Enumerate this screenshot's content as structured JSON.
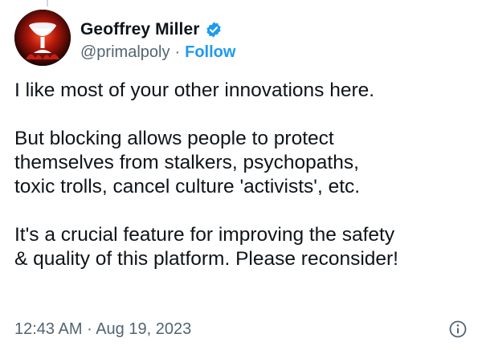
{
  "author": {
    "name": "Geoffrey Miller",
    "handle": "@primalpoly",
    "separator": "·",
    "follow_label": "Follow",
    "verified": true
  },
  "tweet": {
    "paragraphs": [
      [
        "I like most of your other innovations here."
      ],
      [
        "But blocking allows people to protect",
        "themselves from stalkers, psychopaths,",
        "toxic trolls, cancel culture 'activists', etc."
      ],
      [
        "It's a crucial feature for improving the safety",
        "& quality of this platform. Please reconsider!"
      ]
    ],
    "time": "12:43 AM",
    "date_separator": "·",
    "date": "Aug 19, 2023"
  },
  "colors": {
    "accent": "#1d9bf0",
    "text": "#0f1419",
    "secondary": "#536471"
  },
  "icons": {
    "verified": "verified-badge-icon",
    "info": "info-icon"
  }
}
